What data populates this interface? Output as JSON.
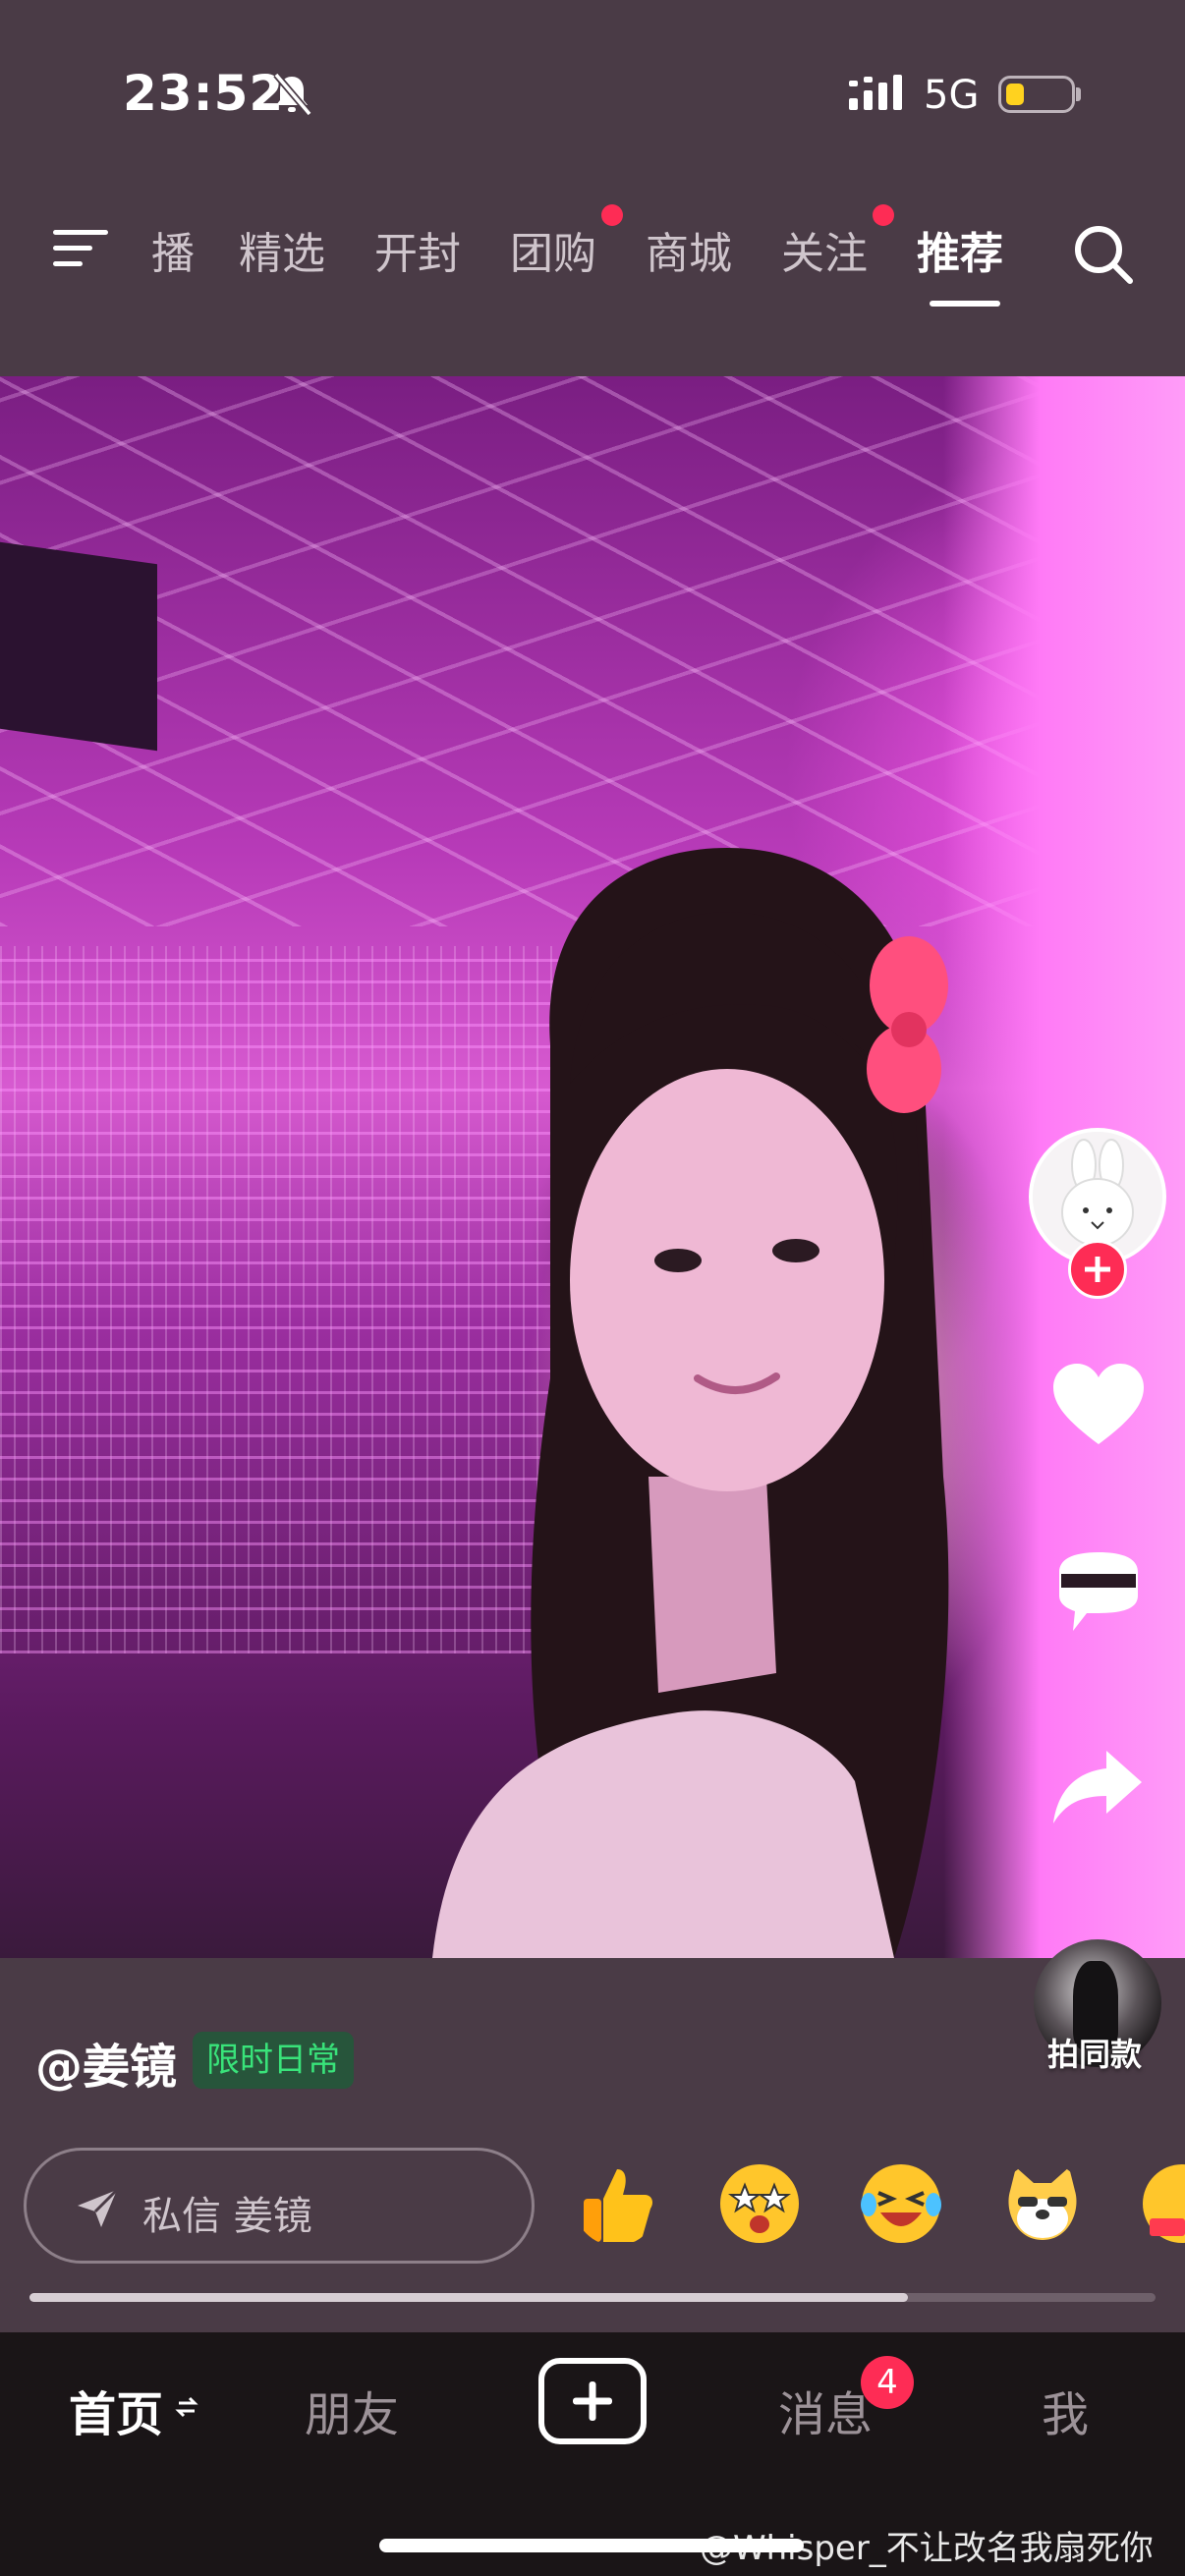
{
  "status_bar": {
    "time": "23:52",
    "network": "5G"
  },
  "top_nav": {
    "tabs": [
      {
        "label": "播",
        "active": false,
        "dot": false
      },
      {
        "label": "精选",
        "active": false,
        "dot": false
      },
      {
        "label": "开封",
        "active": false,
        "dot": false
      },
      {
        "label": "团购",
        "active": false,
        "dot": true
      },
      {
        "label": "商城",
        "active": false,
        "dot": false
      },
      {
        "label": "关注",
        "active": false,
        "dot": true
      },
      {
        "label": "推荐",
        "active": true,
        "dot": false
      }
    ]
  },
  "video": {
    "author": "@姜镜",
    "tag": "限时日常",
    "music_label": "拍同款"
  },
  "dm": {
    "label": "私信 姜镜"
  },
  "emojis": [
    "thumbs-up",
    "star-eyes",
    "laugh-cry",
    "cool-doge",
    "partial-emoji"
  ],
  "progress": 0.78,
  "bottom_nav": {
    "home": "首页",
    "friends": "朋友",
    "messages": "消息",
    "messages_badge": "4",
    "me": "我"
  },
  "watermark": "@Whisper_不让改名我扇死你",
  "colors": {
    "accent": "#fe2c55",
    "tag_text": "#39e37a",
    "tag_bg": "#27553b"
  }
}
